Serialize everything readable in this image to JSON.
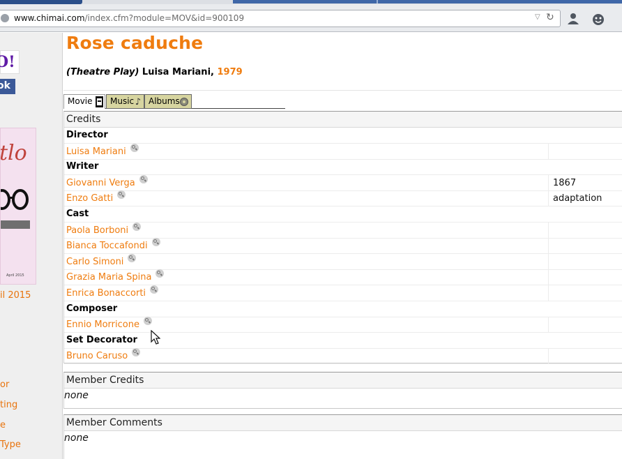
{
  "browser": {
    "url_host": "www.chimai.com",
    "url_path": "/index.cfm?module=MOV&id=900109",
    "icons": [
      "globe-icon",
      "dropdown-arrow-icon",
      "reload-icon",
      "user-icon",
      "chat-emoji-icon"
    ]
  },
  "sidebar": {
    "yahoo_text": "O!",
    "facebook_text": "ok",
    "magazine_date": "April 2015",
    "month_link": "il 2015",
    "links": [
      "or",
      "ting",
      "e",
      "Type"
    ]
  },
  "page": {
    "title": "Rose caduche",
    "subtitle_kind": "(Theatre Play)",
    "subtitle_author": " Luisa Mariani, ",
    "subtitle_year": "1979"
  },
  "tabs": [
    {
      "label": "Movie",
      "icon": "film-icon",
      "active": true
    },
    {
      "label": "Music",
      "icon": "music-note-icon",
      "active": false
    },
    {
      "label": "Albums",
      "icon": "disc-icon",
      "active": false
    }
  ],
  "credits": {
    "heading": "Credits",
    "groups": [
      {
        "role": "Director",
        "people": [
          {
            "name": "Luisa Mariani",
            "note": ""
          }
        ]
      },
      {
        "role": "Writer",
        "people": [
          {
            "name": "Giovanni Verga",
            "note": "1867"
          },
          {
            "name": "Enzo Gatti",
            "note": "adaptation"
          }
        ]
      },
      {
        "role": "Cast",
        "people": [
          {
            "name": "Paola Borboni",
            "note": ""
          },
          {
            "name": "Bianca Toccafondi",
            "note": ""
          },
          {
            "name": "Carlo Simoni",
            "note": ""
          },
          {
            "name": "Grazia Maria Spina",
            "note": ""
          },
          {
            "name": "Enrica Bonaccorti",
            "note": ""
          }
        ]
      },
      {
        "role": "Composer",
        "people": [
          {
            "name": "Ennio Morricone",
            "note": ""
          }
        ]
      },
      {
        "role": "Set Decorator",
        "people": [
          {
            "name": "Bruno Caruso",
            "note": ""
          }
        ]
      }
    ]
  },
  "member_credits": {
    "heading": "Member Credits",
    "value": "none"
  },
  "member_comments": {
    "heading": "Member Comments",
    "value": "none"
  },
  "colors": {
    "accent": "#ef7c0f",
    "tab_inactive": "#d7d5a0"
  }
}
